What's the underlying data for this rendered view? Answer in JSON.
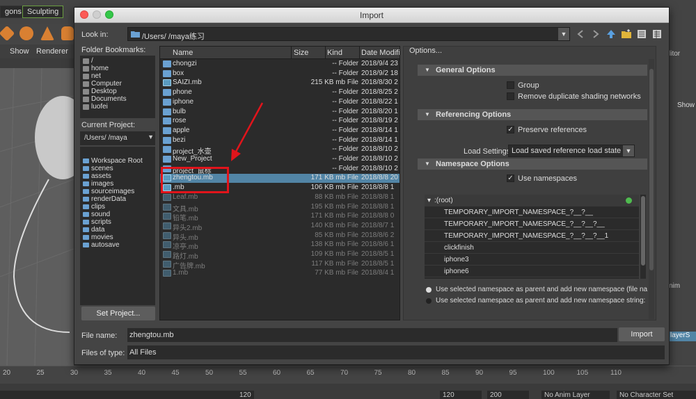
{
  "background": {
    "tabs": {
      "polygons": "gons",
      "sculpting": "Sculpting"
    },
    "menu": {
      "show": "Show",
      "renderer": "Renderer"
    },
    "right": {
      "editor": "litor",
      "show": "Show",
      "anim": "nim",
      "layer": "layerS"
    },
    "timeline": [
      "20",
      "25",
      "30",
      "35",
      "40",
      "45",
      "50",
      "55",
      "60",
      "65",
      "70",
      "75",
      "80",
      "85",
      "90",
      "95",
      "100",
      "105",
      "110"
    ],
    "range": {
      "start_end": "120",
      "val120": "120",
      "val200": "200",
      "anim_layer": "No Anim Layer",
      "char_set": "No Character Set"
    }
  },
  "dialog": {
    "title": "Import",
    "look_in_label": "Look in:",
    "look_in_path": "/Users/        /maya练习",
    "folder_bookmarks_label": "Folder Bookmarks:",
    "bookmarks": [
      "/",
      "home",
      "net",
      "Computer",
      "Desktop",
      "Documents",
      "luofei"
    ],
    "current_project_label": "Current Project:",
    "current_project": "/Users/        /maya",
    "workspace": [
      "Workspace Root",
      "scenes",
      "assets",
      "images",
      "sourceimages",
      "renderData",
      "clips",
      "sound",
      "scripts",
      "data",
      "movies",
      "autosave"
    ],
    "set_project_label": "Set Project...",
    "columns": {
      "name": "Name",
      "size": "Size",
      "kind": "Kind",
      "date": "Date Modifi"
    },
    "files": [
      {
        "name": "chongzi",
        "size": "-- Folder",
        "kind": "",
        "date": "2018/9/4 23",
        "type": "folder"
      },
      {
        "name": "box",
        "size": "-- Folder",
        "kind": "",
        "date": "2018/9/2 18",
        "type": "folder"
      },
      {
        "name": "SAIZI.mb",
        "size": "215 KB mb File",
        "kind": "",
        "date": "2018/8/30 2",
        "type": "mb"
      },
      {
        "name": "phone",
        "size": "-- Folder",
        "kind": "",
        "date": "2018/8/25 2",
        "type": "folder"
      },
      {
        "name": "iphone",
        "size": "-- Folder",
        "kind": "",
        "date": "2018/8/22 1",
        "type": "folder"
      },
      {
        "name": "bulb",
        "size": "-- Folder",
        "kind": "",
        "date": "2018/8/20 1",
        "type": "folder"
      },
      {
        "name": "rose",
        "size": "-- Folder",
        "kind": "",
        "date": "2018/8/19 2",
        "type": "folder"
      },
      {
        "name": "apple",
        "size": "-- Folder",
        "kind": "",
        "date": "2018/8/14 1",
        "type": "folder"
      },
      {
        "name": "bezi",
        "size": "-- Folder",
        "kind": "",
        "date": "2018/8/14 1",
        "type": "folder"
      },
      {
        "name": "project_水壶",
        "size": "-- Folder",
        "kind": "",
        "date": "2018/8/10 2",
        "type": "folder"
      },
      {
        "name": "New_Project",
        "size": "-- Folder",
        "kind": "",
        "date": "2018/8/10 2",
        "type": "folder"
      },
      {
        "name": "project_鼠标",
        "size": "-- Folder",
        "kind": "",
        "date": "2018/8/10 2",
        "type": "folder"
      },
      {
        "name": "zhengtou.mb",
        "size": "171 KB mb File",
        "kind": "",
        "date": "2018/8/8 20",
        "type": "mb",
        "selected": true
      },
      {
        "name": "          .mb",
        "size": "106 KB mb File",
        "kind": "",
        "date": "2018/8/8 1",
        "type": "mb"
      },
      {
        "name": "Leaf.mb",
        "size": "88 KB mb File",
        "kind": "",
        "date": "2018/8/8 1",
        "type": "mb",
        "dim": true
      },
      {
        "name": "文具.mb",
        "size": "195 KB mb File",
        "kind": "",
        "date": "2018/8/8 1",
        "type": "mb",
        "dim": true
      },
      {
        "name": "铅笔.mb",
        "size": "171 KB mb File",
        "kind": "",
        "date": "2018/8/8 0",
        "type": "mb",
        "dim": true
      },
      {
        "name": "异头2.mb",
        "size": "140 KB mb File",
        "kind": "",
        "date": "2018/8/7 1",
        "type": "mb",
        "dim": true
      },
      {
        "name": "异头.mb",
        "size": "85 KB mb File",
        "kind": "",
        "date": "2018/8/6 2",
        "type": "mb",
        "dim": true
      },
      {
        "name": "凉亭.mb",
        "size": "138 KB mb File",
        "kind": "",
        "date": "2018/8/6 1",
        "type": "mb",
        "dim": true
      },
      {
        "name": "路灯.mb",
        "size": "109 KB mb File",
        "kind": "",
        "date": "2018/8/5 1",
        "type": "mb",
        "dim": true
      },
      {
        "name": "广告牌.mb",
        "size": "117 KB mb File",
        "kind": "",
        "date": "2018/8/5 1",
        "type": "mb",
        "dim": true
      },
      {
        "name": "1.mb",
        "size": "77 KB mb File",
        "kind": "",
        "date": "2018/8/4 1",
        "type": "mb",
        "dim": true
      }
    ],
    "options_title": "Options...",
    "general_options": "General Options",
    "group_label": "Group",
    "remove_dup_label": "Remove duplicate shading networks",
    "referencing_options": "Referencing Options",
    "preserve_refs_label": "Preserve references",
    "load_settings_label": "Load Settings",
    "load_settings_value": "Load saved reference load state",
    "namespace_options": "Namespace Options",
    "use_namespaces_label": "Use namespaces",
    "namespaces": [
      ":(root)",
      "TEMPORARY_IMPORT_NAMESPACE_?__?__",
      "TEMPORARY_IMPORT_NAMESPACE_?__?__?__",
      "TEMPORARY_IMPORT_NAMESPACE_?__?__?__1",
      "clickfinish",
      "iphone3",
      "iphone6"
    ],
    "radio_parent": "Use selected namespace as parent and add new namespace (file na",
    "radio_string": "Use selected namespace as parent and add new namespace string:",
    "file_name_label": "File name:",
    "file_name_value": "zhengtou.mb",
    "import_button": "Import",
    "files_of_type_label": "Files of type:",
    "files_of_type_value": "All Files"
  },
  "colors": {
    "selection": "#5285a6",
    "highlight_box": "#e1141b",
    "arrow": "#e1141b"
  }
}
